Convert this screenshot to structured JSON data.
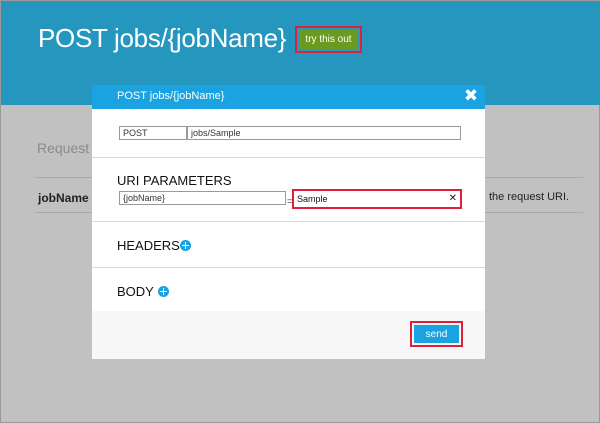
{
  "page": {
    "title": "POST jobs/{jobName}",
    "try_button": "try this out"
  },
  "background": {
    "request_label": "Request",
    "param_name": "jobName",
    "param_description": "the request URI."
  },
  "modal": {
    "title": "POST jobs/{jobName}",
    "close_icon": "close-icon",
    "method": "POST",
    "url": "jobs/Sample",
    "uri_parameters": {
      "heading": "URI PARAMETERS",
      "name": "{jobName}",
      "equals": "=",
      "value": "Sample"
    },
    "headers_label": "HEADERS",
    "body_label": "BODY",
    "send_label": "send"
  },
  "colors": {
    "header_bg": "#2596be",
    "modal_header_bg": "#1aa3e0",
    "try_button_bg": "#6a9a1f",
    "highlight_border": "#e0203a",
    "overlay_bg": "#c1c1c1"
  }
}
